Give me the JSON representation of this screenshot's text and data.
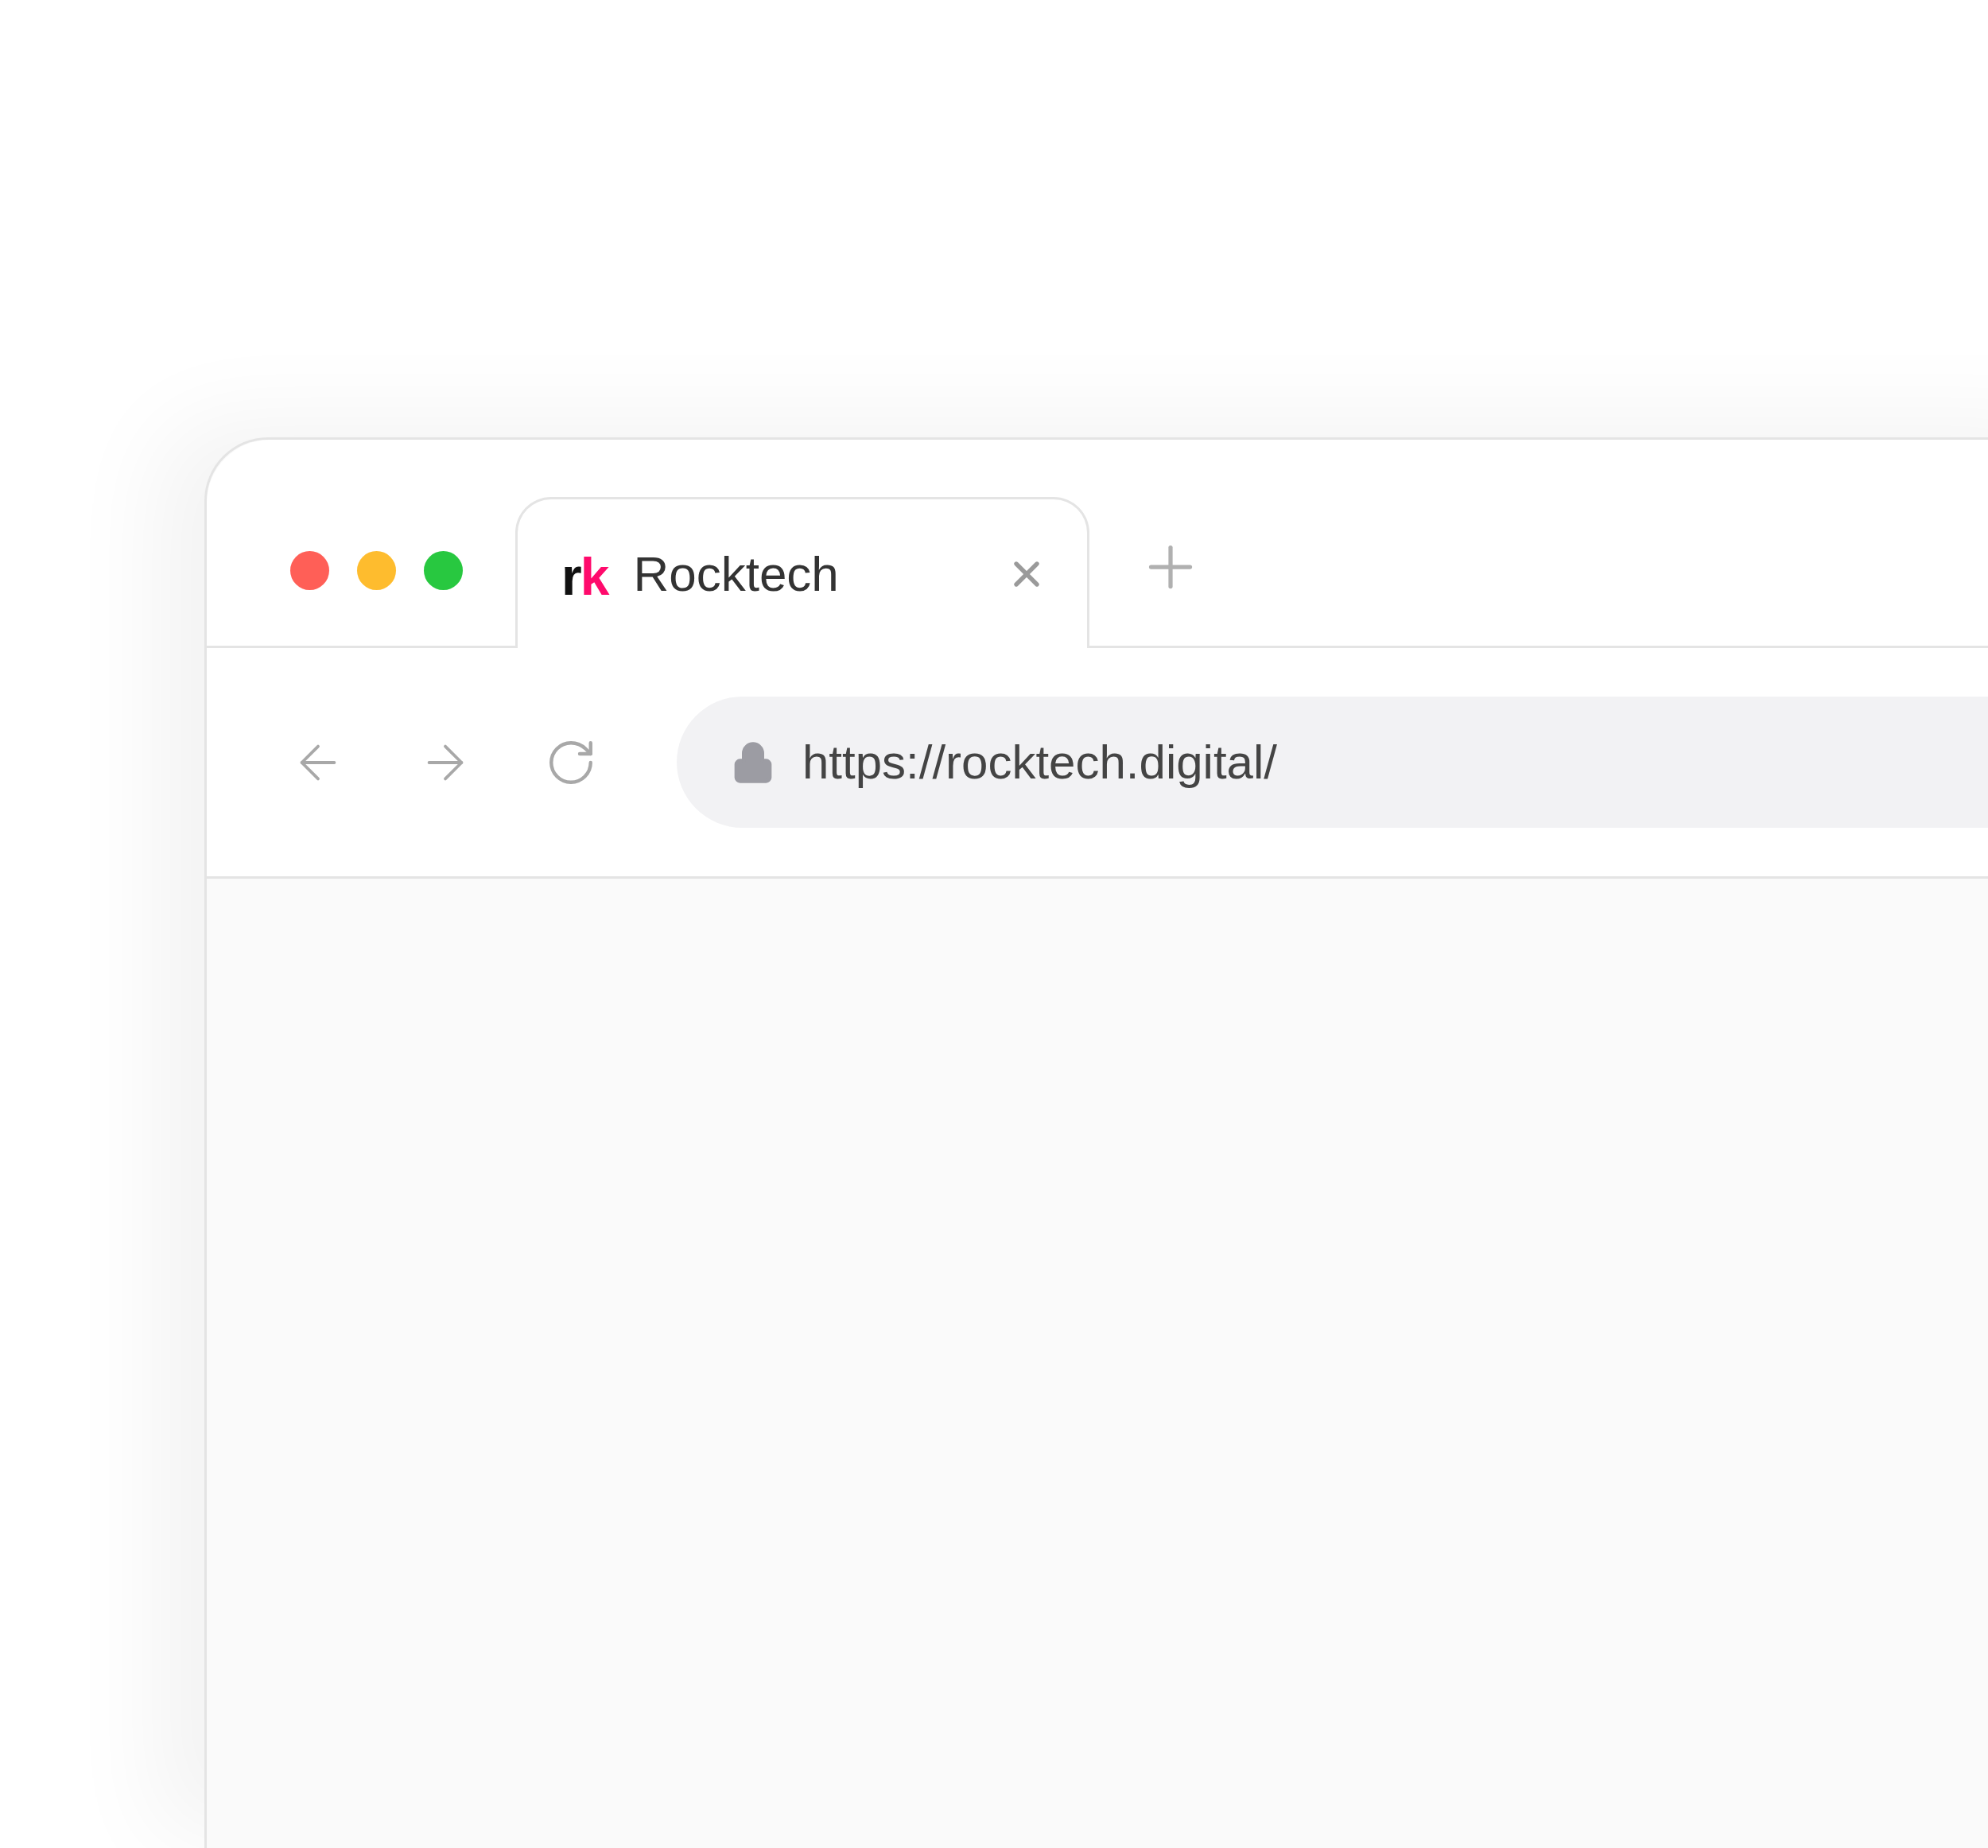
{
  "window_controls": [
    {
      "color": "#ff5f57"
    },
    {
      "color": "#febc2e"
    },
    {
      "color": "#28c840"
    }
  ],
  "tabs": [
    {
      "logo": [
        {
          "text": "r",
          "color": "#111111"
        },
        {
          "text": "k",
          "color": "#ff0a6c"
        }
      ],
      "title": "Rocktech",
      "selected": true
    }
  ],
  "address_bar": {
    "url": "https://rocktech.digital/"
  }
}
